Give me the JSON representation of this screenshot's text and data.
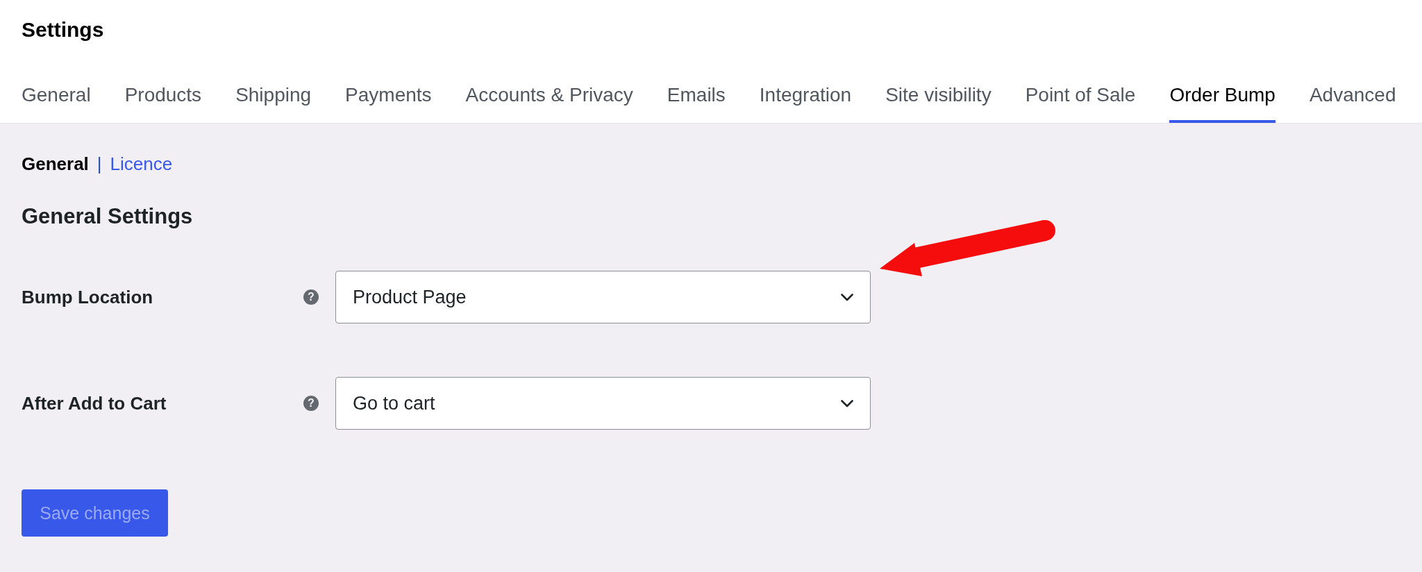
{
  "page": {
    "title": "Settings"
  },
  "tabs": [
    {
      "label": "General",
      "selected": false
    },
    {
      "label": "Products",
      "selected": false
    },
    {
      "label": "Shipping",
      "selected": false
    },
    {
      "label": "Payments",
      "selected": false
    },
    {
      "label": "Accounts & Privacy",
      "selected": false
    },
    {
      "label": "Emails",
      "selected": false
    },
    {
      "label": "Integration",
      "selected": false
    },
    {
      "label": "Site visibility",
      "selected": false
    },
    {
      "label": "Point of Sale",
      "selected": false
    },
    {
      "label": "Order Bump",
      "selected": true
    },
    {
      "label": "Advanced",
      "selected": false
    }
  ],
  "subnav": {
    "separator": "|",
    "items": [
      {
        "label": "General",
        "selected": true
      },
      {
        "label": "Licence",
        "selected": false
      }
    ]
  },
  "section": {
    "heading": "General Settings"
  },
  "fields": [
    {
      "label": "Bump Location",
      "help_icon": "?",
      "value": "Product Page"
    },
    {
      "label": "After Add to Cart",
      "help_icon": "?",
      "value": "Go to cart"
    }
  ],
  "save_button": {
    "label": "Save changes",
    "disabled": true
  }
}
